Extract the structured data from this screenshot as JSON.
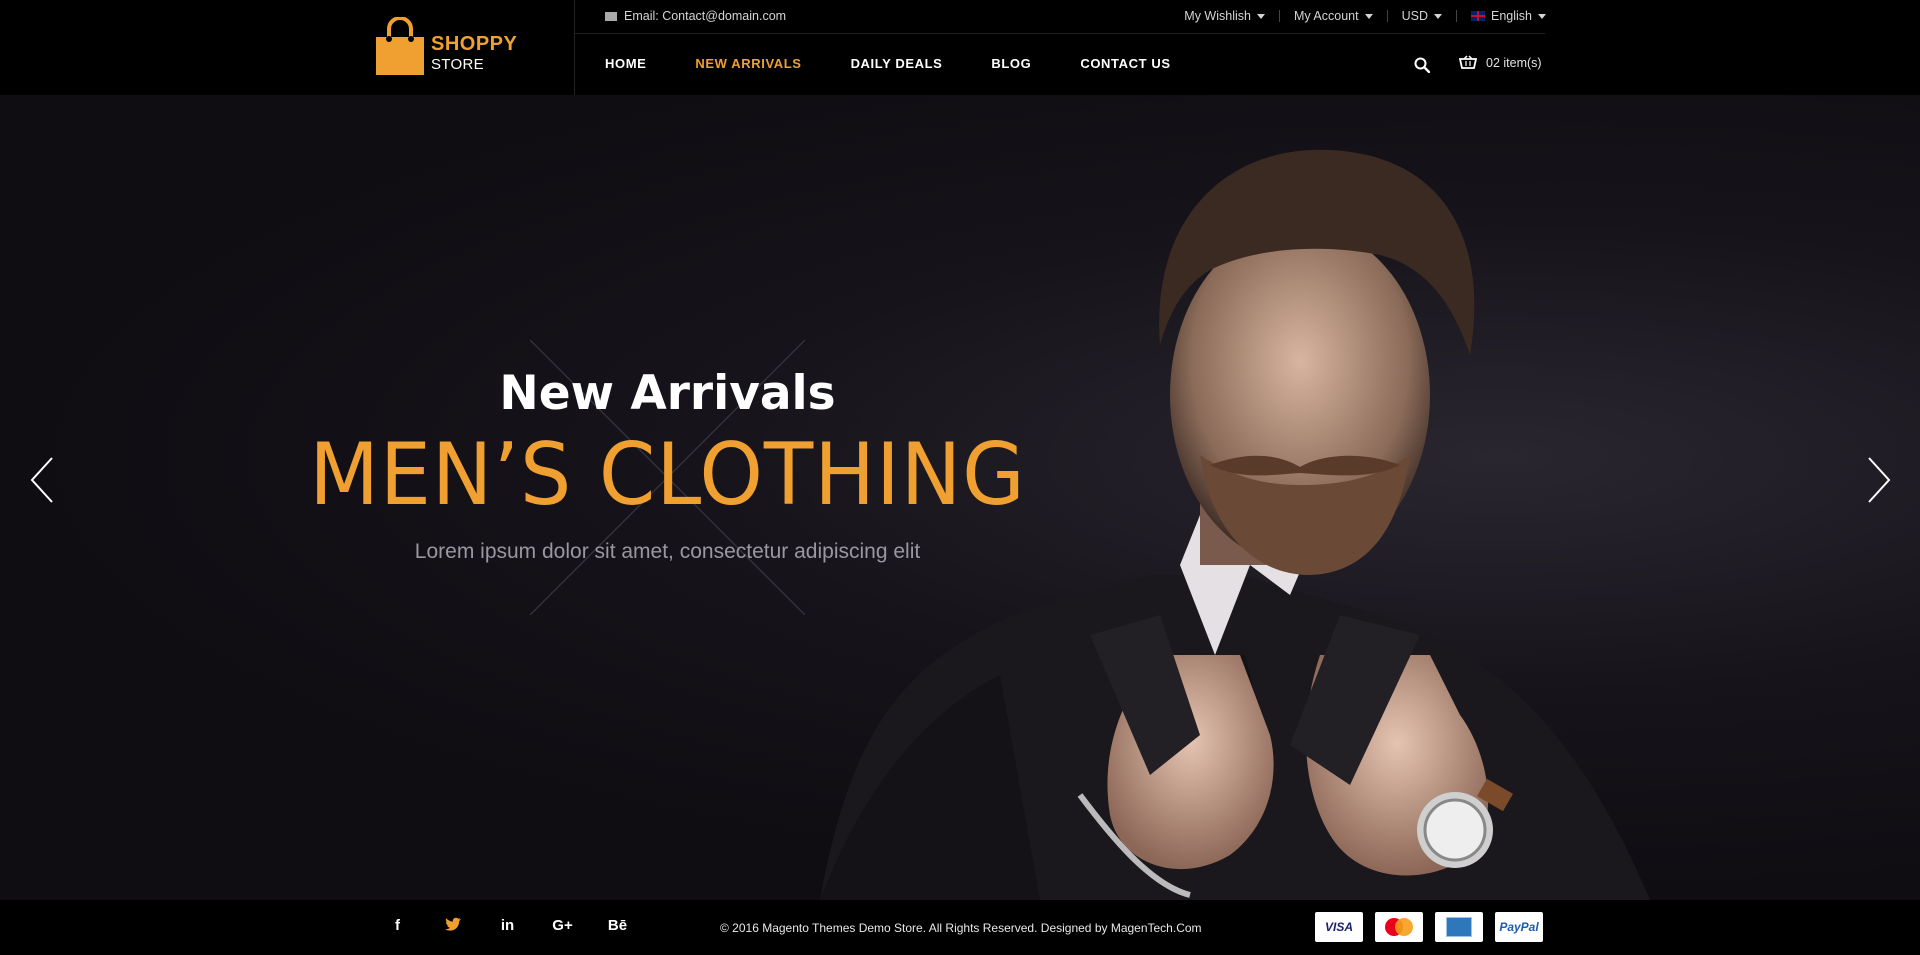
{
  "brand": {
    "name_top": "SHOPPY",
    "name_bottom": "STORE"
  },
  "topbar": {
    "email": "Email: Contact@domain.com",
    "wishlist": "My Wishlish",
    "account": "My Account",
    "currency": "USD",
    "language": "English"
  },
  "nav": {
    "items": [
      "HOME",
      "NEW ARRIVALS",
      "DAILY DEALS",
      "BLOG",
      "CONTACT US"
    ],
    "active_index": 1
  },
  "cart": {
    "label": "02 item(s)"
  },
  "hero": {
    "title": "New Arrivals",
    "heading": "MEN’S CLOTHING",
    "subtitle": "Lorem ipsum dolor sit amet, consectetur adipiscing elit"
  },
  "footer": {
    "social": [
      "f",
      "t",
      "in",
      "G+",
      "Bē"
    ],
    "copyright": "© 2016 Magento Themes Demo Store. All Rights Reserved. Designed by MagenTech.Com",
    "payments": [
      "VISA",
      "MasterCard",
      "AMEX",
      "PayPal"
    ]
  },
  "colors": {
    "accent": "#f0a030",
    "background": "#0f0d12",
    "header": "#000000"
  },
  "icons": [
    "shopping-bag-logo-icon",
    "mail-icon",
    "search-icon",
    "cart-icon",
    "arrow-left-icon",
    "arrow-right-icon",
    "facebook-icon",
    "twitter-icon",
    "linkedin-icon",
    "google-plus-icon",
    "behance-icon"
  ]
}
